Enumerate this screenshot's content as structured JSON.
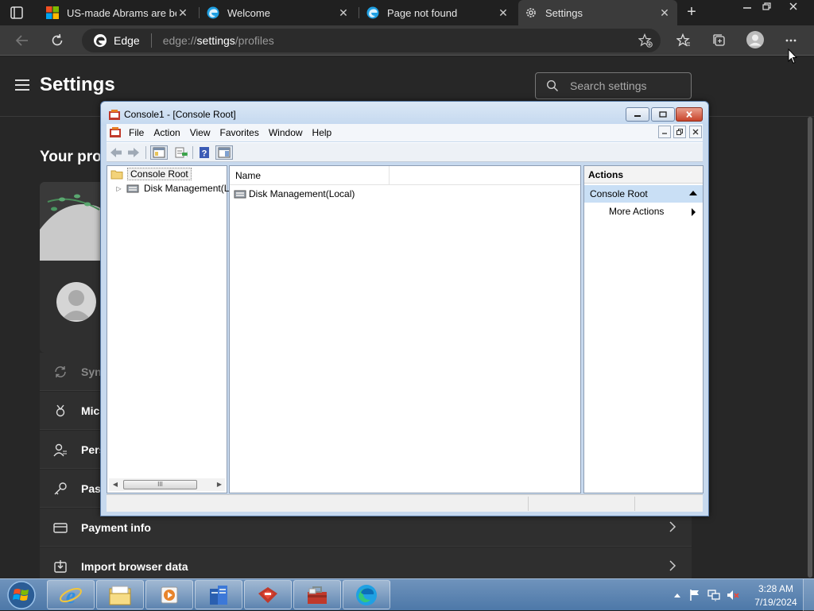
{
  "browser": {
    "tabs": [
      {
        "title": "US-made Abrams are bet",
        "favicon": "microsoft-logo-icon",
        "close": "✕"
      },
      {
        "title": "Welcome",
        "favicon": "edge-icon",
        "close": "✕"
      },
      {
        "title": "Page not found",
        "favicon": "edge-icon",
        "close": "✕"
      },
      {
        "title": "Settings",
        "favicon": "gear-icon",
        "close": "✕"
      }
    ],
    "new_tab": "+",
    "address": {
      "site_name": "Edge",
      "url_prefix": "edge://",
      "url_path": "settings",
      "url_rest": "/profiles"
    }
  },
  "settings": {
    "title": "Settings",
    "search_placeholder": "Search settings",
    "section_heading": "Your pro",
    "rows": [
      {
        "label": "Syn",
        "icon": "sync-icon",
        "muted": true
      },
      {
        "label": "Mic",
        "icon": "rewards-icon",
        "muted": false
      },
      {
        "label": "Pers",
        "icon": "personal-info-icon",
        "muted": false
      },
      {
        "label": "Pass",
        "icon": "key-icon",
        "muted": false
      },
      {
        "label": "Payment info",
        "icon": "card-icon",
        "muted": false
      },
      {
        "label": "Import browser data",
        "icon": "import-icon",
        "muted": false
      }
    ]
  },
  "mmc": {
    "title": "Console1 - [Console Root]",
    "menu": [
      "File",
      "Action",
      "View",
      "Favorites",
      "Window",
      "Help"
    ],
    "tree": {
      "root": "Console Root",
      "child": "Disk Management(L"
    },
    "center": {
      "column_name": "Name",
      "items": [
        "Disk Management(Local)"
      ]
    },
    "actions": {
      "header": "Actions",
      "section": "Console Root",
      "more": "More Actions"
    },
    "scroll_thumb": "III"
  },
  "taskbar": {
    "apps": [
      "ie-icon",
      "explorer-icon",
      "media-player-icon",
      "server-manager-icon",
      "red-app-icon",
      "toolbox-icon",
      "edge-icon"
    ],
    "time": "3:28 AM",
    "date": "7/19/2024"
  }
}
